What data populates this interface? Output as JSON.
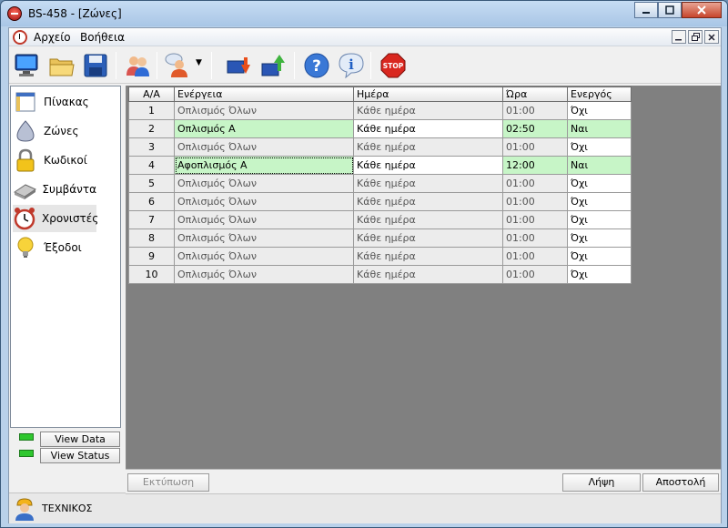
{
  "window": {
    "title": "BS-458 - [Ζώνες]"
  },
  "menu": {
    "items": [
      "Αρχείο",
      "Βοήθεια"
    ]
  },
  "toolbar": {
    "buttons": [
      "monitor-icon",
      "folder-open-icon",
      "save-icon",
      "users-icon",
      "user-chat-icon",
      "download-icon",
      "upload-icon",
      "help-icon",
      "info-icon",
      "stop-icon"
    ],
    "stop_label": "STOP"
  },
  "sidebar": {
    "items": [
      {
        "label": "Πίνακας",
        "icon": "panel-icon"
      },
      {
        "label": "Ζώνες",
        "icon": "zones-icon"
      },
      {
        "label": "Κωδικοί",
        "icon": "lock-icon"
      },
      {
        "label": "Συμβάντα",
        "icon": "events-icon"
      },
      {
        "label": "Χρονιστές",
        "icon": "alarm-clock-icon"
      },
      {
        "label": "Έξοδοι",
        "icon": "lightbulb-icon"
      }
    ],
    "active_index": 4
  },
  "status": {
    "view_data": "View Data",
    "view_status": "View Status",
    "led_color": "#2ec62e"
  },
  "user": {
    "label": "ΤΕΧΝΙΚΟΣ"
  },
  "table": {
    "headers": [
      "Α/Α",
      "Ενέργεια",
      "Ημέρα",
      "Ώρα",
      "Ενεργός"
    ],
    "rows": [
      {
        "num": "1",
        "action": "Οπλισμός Όλων",
        "day": "Κάθε ημέρα",
        "time": "01:00",
        "active": "Όχι"
      },
      {
        "num": "2",
        "action": "Οπλισμός Α",
        "day": "Κάθε ημέρα",
        "time": "02:50",
        "active": "Ναι"
      },
      {
        "num": "3",
        "action": "Οπλισμός Όλων",
        "day": "Κάθε ημέρα",
        "time": "01:00",
        "active": "Όχι"
      },
      {
        "num": "4",
        "action": "Αφοπλισμός Α",
        "day": "Κάθε ημέρα",
        "time": "12:00",
        "active": "Ναι"
      },
      {
        "num": "5",
        "action": "Οπλισμός Όλων",
        "day": "Κάθε ημέρα",
        "time": "01:00",
        "active": "Όχι"
      },
      {
        "num": "6",
        "action": "Οπλισμός Όλων",
        "day": "Κάθε ημέρα",
        "time": "01:00",
        "active": "Όχι"
      },
      {
        "num": "7",
        "action": "Οπλισμός Όλων",
        "day": "Κάθε ημέρα",
        "time": "01:00",
        "active": "Όχι"
      },
      {
        "num": "8",
        "action": "Οπλισμός Όλων",
        "day": "Κάθε ημέρα",
        "time": "01:00",
        "active": "Όχι"
      },
      {
        "num": "9",
        "action": "Οπλισμός Όλων",
        "day": "Κάθε ημέρα",
        "time": "01:00",
        "active": "Όχι"
      },
      {
        "num": "10",
        "action": "Οπλισμός Όλων",
        "day": "Κάθε ημέρα",
        "time": "01:00",
        "active": "Όχι"
      }
    ],
    "selected_row": 3
  },
  "bottom": {
    "print": "Εκτύπωση",
    "receive": "Λήψη",
    "send": "Αποστολή"
  },
  "colors": {
    "enabled_row": "#c7f5c7",
    "content_bg": "#808080"
  }
}
